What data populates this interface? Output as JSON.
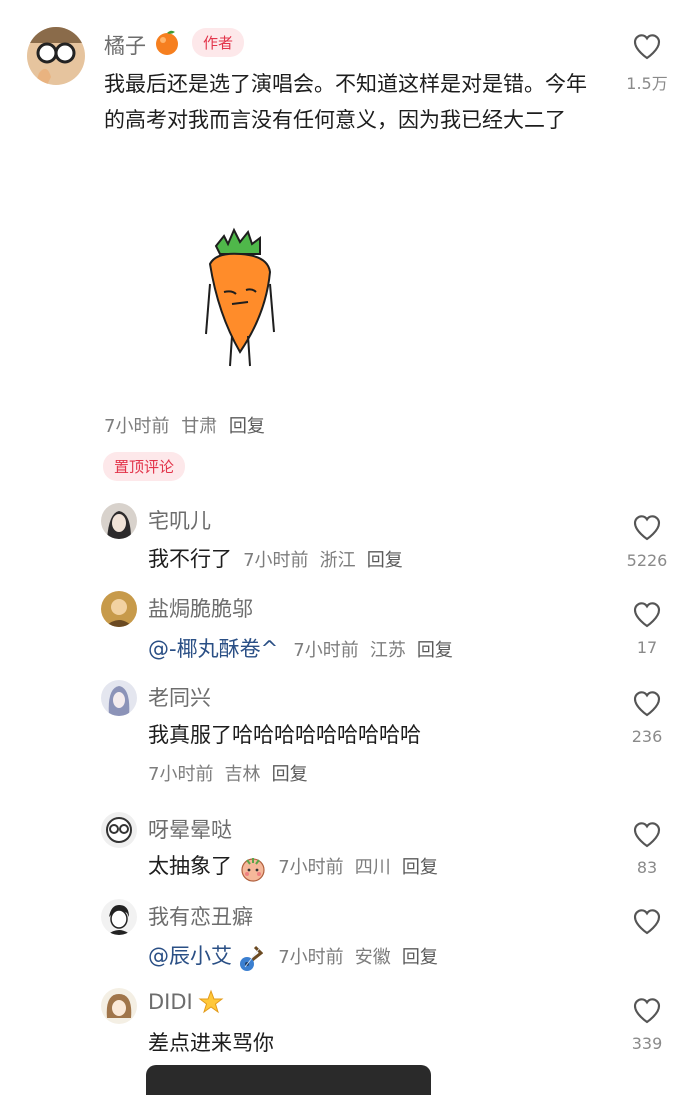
{
  "main_comment": {
    "author": "橘子",
    "author_tag": "作者",
    "text": "我最后还是选了演唱会。不知道这样是对是错。今年的高考对我而言没有任何意义，因为我已经大二了",
    "time": "7小时前",
    "location": "甘肃",
    "reply": "回复",
    "likes": "1.5万"
  },
  "pinned_label": "置顶评论",
  "replies": [
    {
      "name": "宅叽儿",
      "text": "我不行了",
      "time": "7小时前",
      "location": "浙江",
      "reply": "回复",
      "likes": "5226"
    },
    {
      "name": "盐焗脆脆邬",
      "mention": "@-椰丸酥卷^",
      "time": "7小时前",
      "location": "江苏",
      "reply": "回复",
      "likes": "17"
    },
    {
      "name": "老同兴",
      "text": "我真服了哈哈哈哈哈哈哈哈哈",
      "time": "7小时前",
      "location": "吉林",
      "reply": "回复",
      "likes": "236"
    },
    {
      "name": "呀晕晕哒",
      "text": "太抽象了",
      "time": "7小时前",
      "location": "四川",
      "reply": "回复",
      "likes": "83"
    },
    {
      "name": "我有恋丑癖",
      "mention": "@辰小艾",
      "time": "7小时前",
      "location": "安徽",
      "reply": "回复",
      "likes": ""
    },
    {
      "name": "DIDI",
      "text": "差点进来骂你",
      "likes": "339"
    }
  ],
  "icons": {
    "heart": "heart-icon",
    "orange": "orange-emoji-icon",
    "sticker": "carrot-sticker",
    "face": "shy-face-emoji-icon",
    "guitar": "guitar-emoji-icon",
    "sparkle": "star-emoji-icon"
  }
}
